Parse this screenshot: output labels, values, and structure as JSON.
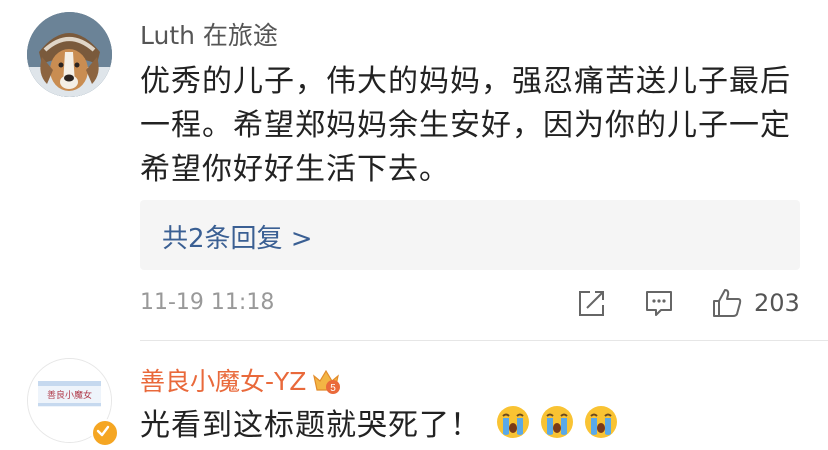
{
  "comment1": {
    "username": "Luth 在旅途",
    "text": "优秀的儿子，伟大的妈妈，强忍痛苦送儿子最后一程。希望郑妈妈余生安好，因为你的儿子一定希望你好好生活下去。",
    "replies_label": "共2条回复 >",
    "timestamp": "11-19 11:18",
    "like_count": "203",
    "icons": [
      "share-icon",
      "comment-icon",
      "like-icon"
    ]
  },
  "comment2": {
    "username": "善良小魔女-YZ",
    "badge": "5",
    "avatar_text": "善良小魔女",
    "text": "光看到这标题就哭死了！",
    "emoji_count": 3,
    "icons": [
      "crying-face-icon",
      "vip-crown-icon",
      "verified-icon"
    ]
  },
  "colors": {
    "link": "#3a5f93",
    "username_vip": "#e9693b",
    "text": "#222222",
    "meta": "#999999",
    "reply_bg": "#f5f5f5"
  }
}
